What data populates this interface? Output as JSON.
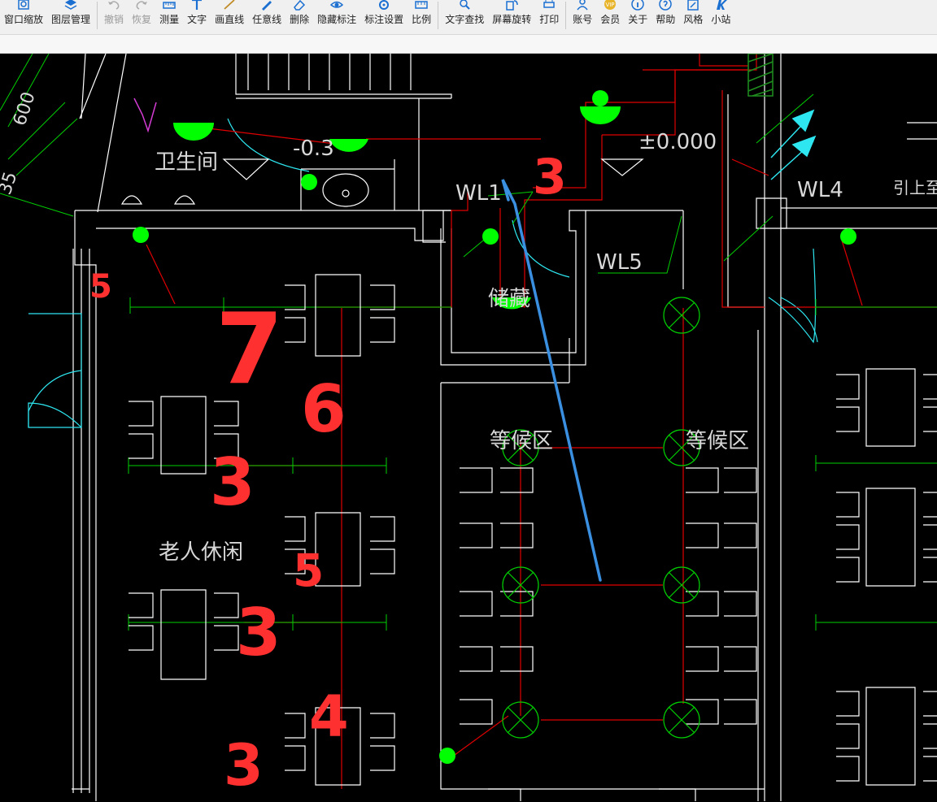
{
  "toolbar": {
    "items": [
      {
        "label": "窗口缩放",
        "icon": "zoom-window-icon",
        "enabled": true
      },
      {
        "label": "图层管理",
        "icon": "layers-icon",
        "enabled": true
      },
      {
        "label": "撤销",
        "icon": "undo-icon",
        "enabled": false
      },
      {
        "label": "恢复",
        "icon": "redo-icon",
        "enabled": false
      },
      {
        "label": "测量",
        "icon": "measure-icon",
        "enabled": true
      },
      {
        "label": "文字",
        "icon": "text-icon",
        "enabled": true
      },
      {
        "label": "画直线",
        "icon": "line-icon",
        "enabled": true
      },
      {
        "label": "任意线",
        "icon": "freehand-icon",
        "enabled": true
      },
      {
        "label": "删除",
        "icon": "eraser-icon",
        "enabled": true
      },
      {
        "label": "隐藏标注",
        "icon": "eye-icon",
        "enabled": true
      },
      {
        "label": "标注设置",
        "icon": "settings-icon",
        "enabled": true
      },
      {
        "label": "比例",
        "icon": "scale-icon",
        "enabled": true
      },
      {
        "label": "文字查找",
        "icon": "text-search-icon",
        "enabled": true
      },
      {
        "label": "屏幕旋转",
        "icon": "rotate-icon",
        "enabled": true
      },
      {
        "label": "打印",
        "icon": "print-icon",
        "enabled": true
      },
      {
        "label": "账号",
        "icon": "user-icon",
        "enabled": true
      },
      {
        "label": "会员",
        "icon": "vip-icon",
        "enabled": true
      },
      {
        "label": "关于",
        "icon": "info-icon",
        "enabled": true
      },
      {
        "label": "帮助",
        "icon": "help-icon",
        "enabled": true
      },
      {
        "label": "风格",
        "icon": "style-icon",
        "enabled": true
      },
      {
        "label": "小站",
        "icon": "station-icon",
        "enabled": true
      }
    ]
  },
  "drawing": {
    "room_labels": {
      "toilet": "卫生间",
      "storage": "储藏",
      "waiting_1": "等候区",
      "waiting_2": "等候区",
      "elderly_leisure": "老人休闲",
      "riser_note": "引上至"
    },
    "level_labels": {
      "minus": "-0.3",
      "zero": "±0.000"
    },
    "pipe_labels": {
      "wl1": "WL1",
      "wl4": "WL4",
      "wl5": "WL5"
    },
    "dimension_labels": {
      "d600": "600",
      "d35": "35"
    },
    "handwritten_numbers": [
      "3",
      "5",
      "7",
      "6",
      "3",
      "5",
      "3",
      "4",
      "3"
    ],
    "colors": {
      "wall": "#ffffff",
      "dimension": "#00d000",
      "pipe": "#e00000",
      "fixture": "#00ff00",
      "door": "#2ee6f0",
      "annotation_red": "#ff3030",
      "annotation_blue": "#3a8fe0",
      "magenta": "#d43cd4",
      "hatch": "#1f8f1f"
    }
  }
}
